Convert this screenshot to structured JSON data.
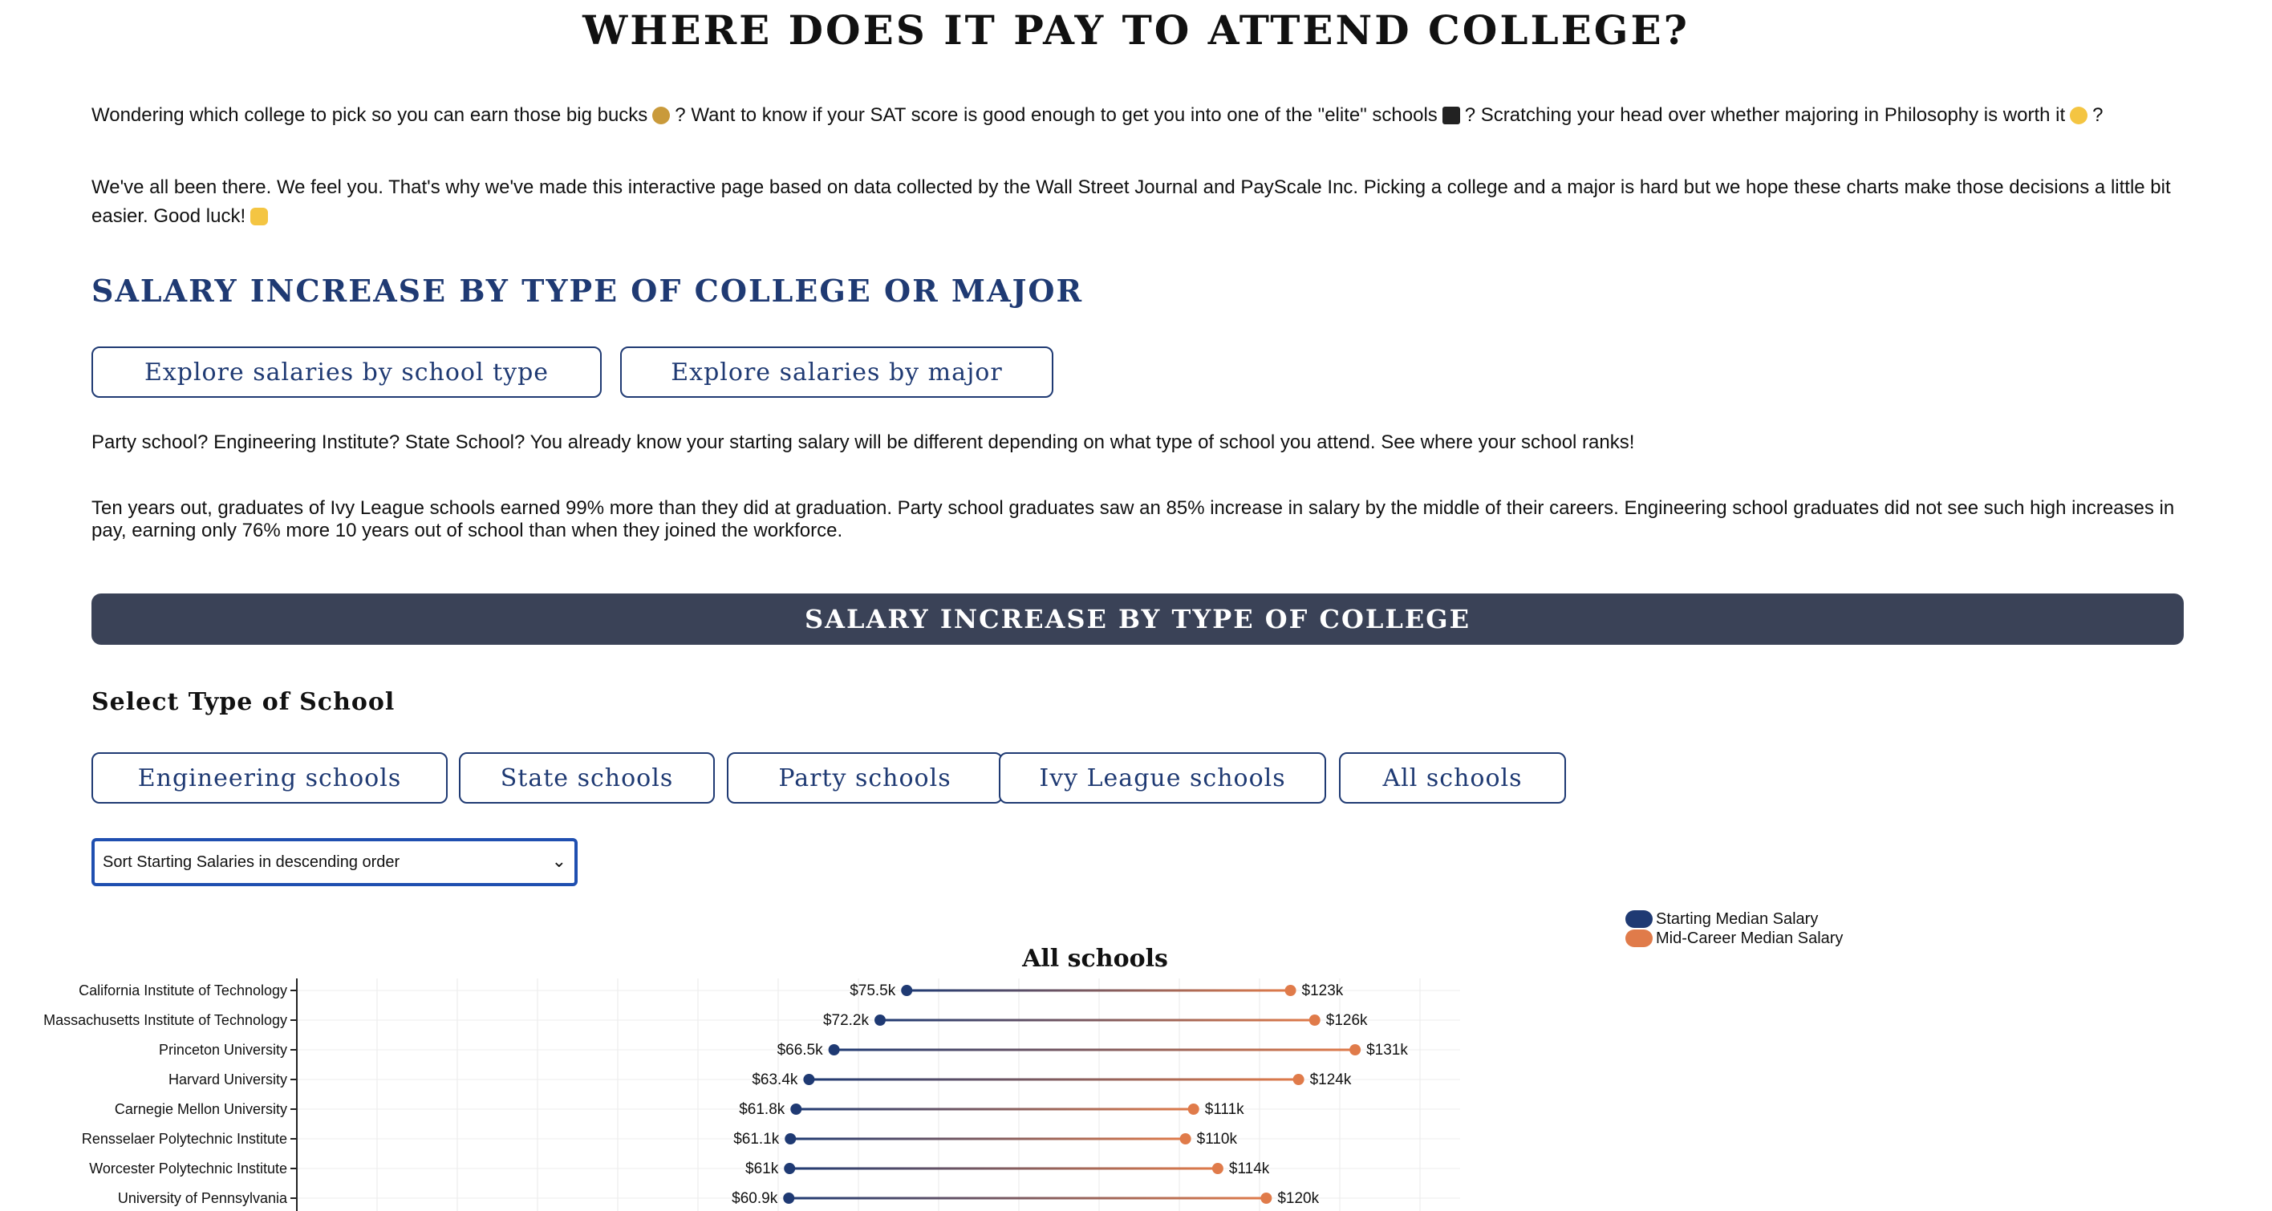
{
  "page": {
    "title": "WHERE DOES IT PAY TO ATTEND COLLEGE?",
    "intro1": {
      "part1": "Wondering which college to pick so you can earn those big bucks",
      "part2": "? Want to know if your SAT score is good enough to get you into one of the \"elite\" schools",
      "part3": "? Scratching your head over whether majoring in Philosophy is worth it",
      "part4": "?"
    },
    "intro2": {
      "text": "We've all been there. We feel you. That's why we've made this interactive page based on data collected by the Wall Street Journal and PayScale Inc. Picking a college and a major is hard but we hope these charts make those decisions a little bit easier. Good luck!"
    },
    "section_heading": "SALARY INCREASE BY TYPE OF COLLEGE OR MAJOR",
    "buttons": {
      "school_type": "Explore salaries by school type",
      "major": "Explore salaries by major"
    },
    "desc1": "Party school? Engineering Institute? State School? You already know your starting salary will be different depending on what type of school you attend. See where your school ranks!",
    "desc2": "Ten years out, graduates of Ivy League schools earned 99% more than they did at graduation. Party school graduates saw an 85% increase in salary by the middle of their careers. Engineering school graduates did not see such high increases in pay, earning only 76% more 10 years out of school than when they joined the workforce.",
    "banner": "SALARY INCREASE BY TYPE OF COLLEGE",
    "select_label": "Select Type of School",
    "filters": [
      "Engineering schools",
      "State schools",
      "Party schools",
      "Ivy League schools",
      "All schools"
    ],
    "sort": {
      "selected": "Sort Starting Salaries in descending order"
    },
    "icons": {
      "intro": [
        "money-bag-icon",
        "graduation-cap-icon",
        "thinking-face-icon",
        "thumbs-up-icon"
      ]
    },
    "colors": {
      "navy": "#1f3a73",
      "starting": "#1f3a73",
      "mid": "#e07b4a",
      "banner": "#3a4257"
    }
  },
  "chart_data": {
    "type": "dumbbell",
    "title": "All schools",
    "legend": [
      "Starting Median Salary",
      "Mid-Career Median Salary"
    ],
    "legend_position": "top-right",
    "grid": true,
    "categories": [
      "California Institute of Technology",
      "Massachusetts Institute of Technology",
      "Princeton University",
      "Harvard University",
      "Carnegie Mellon University",
      "Rensselaer Polytechnic Institute",
      "Worcester Polytechnic Institute",
      "University of Pennsylvania"
    ],
    "series": [
      {
        "name": "Starting Median Salary",
        "values": [
          75.5,
          72.2,
          66.5,
          63.4,
          61.8,
          61.1,
          61.0,
          60.9
        ],
        "labels": [
          "$75.5k",
          "$72.2k",
          "$66.5k",
          "$63.4k",
          "$61.8k",
          "$61.1k",
          "$61k",
          "$60.9k"
        ]
      },
      {
        "name": "Mid-Career Median Salary",
        "values": [
          123,
          126,
          131,
          124,
          111,
          110,
          114,
          120
        ],
        "labels": [
          "$123k",
          "$126k",
          "$131k",
          "$124k",
          "$111k",
          "$110k",
          "$114k",
          "$120k"
        ]
      }
    ],
    "xlim": [
      0,
      144
    ]
  }
}
